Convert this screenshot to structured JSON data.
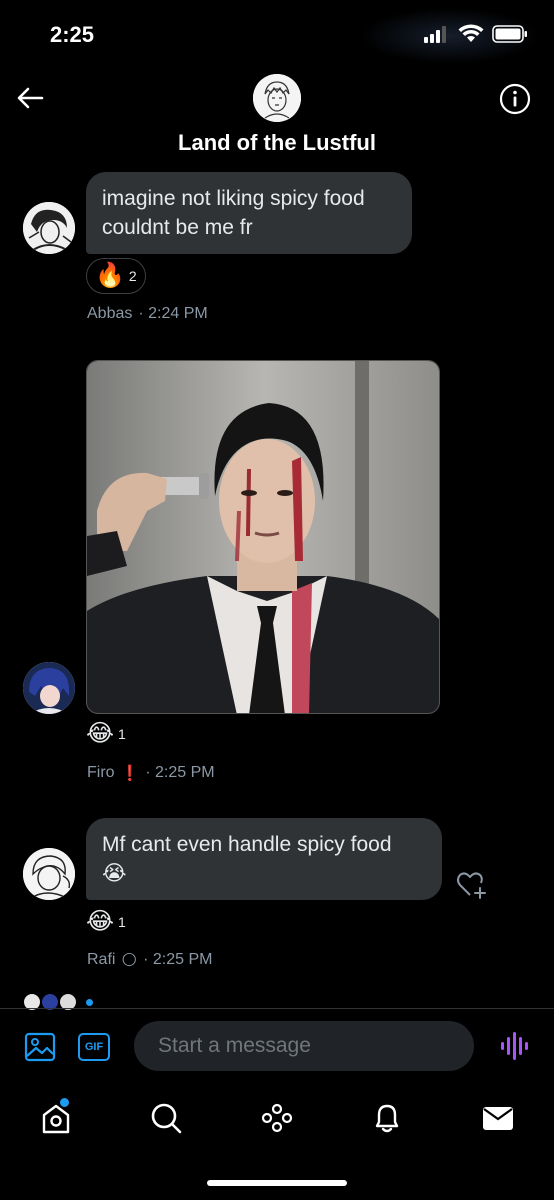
{
  "status_bar": {
    "time": "2:25"
  },
  "header": {
    "title": "Land of the Lustful"
  },
  "messages": [
    {
      "text": "imagine not liking spicy food couldnt be me fr",
      "reaction": {
        "emoji": "🔥",
        "count": "2"
      },
      "sender": "Abbas",
      "time": "· 2:24 PM"
    },
    {
      "type": "image",
      "reaction": {
        "emoji": "😂",
        "count": "1"
      },
      "sender": "Firo",
      "sender_badge": "❗",
      "time": "· 2:25 PM"
    },
    {
      "text": "Mf cant even handle spicy food",
      "text_emoji": "😭",
      "reaction": {
        "emoji": "😂",
        "count": "1"
      },
      "sender": "Rafi",
      "sender_badge": "🌕",
      "time": "· 2:25 PM"
    }
  ],
  "composer": {
    "placeholder": "Start a message",
    "gif_label": "GIF"
  },
  "colors": {
    "accent": "#1d9bf0",
    "bubble": "#2f3336",
    "background": "#000000",
    "voice": "#a855f7"
  },
  "icons": [
    "back-arrow-icon",
    "info-icon",
    "image-icon",
    "gif-icon",
    "voice-icon",
    "home-icon",
    "search-icon",
    "spaces-icon",
    "bell-icon",
    "mail-icon",
    "heart-plus-icon"
  ]
}
